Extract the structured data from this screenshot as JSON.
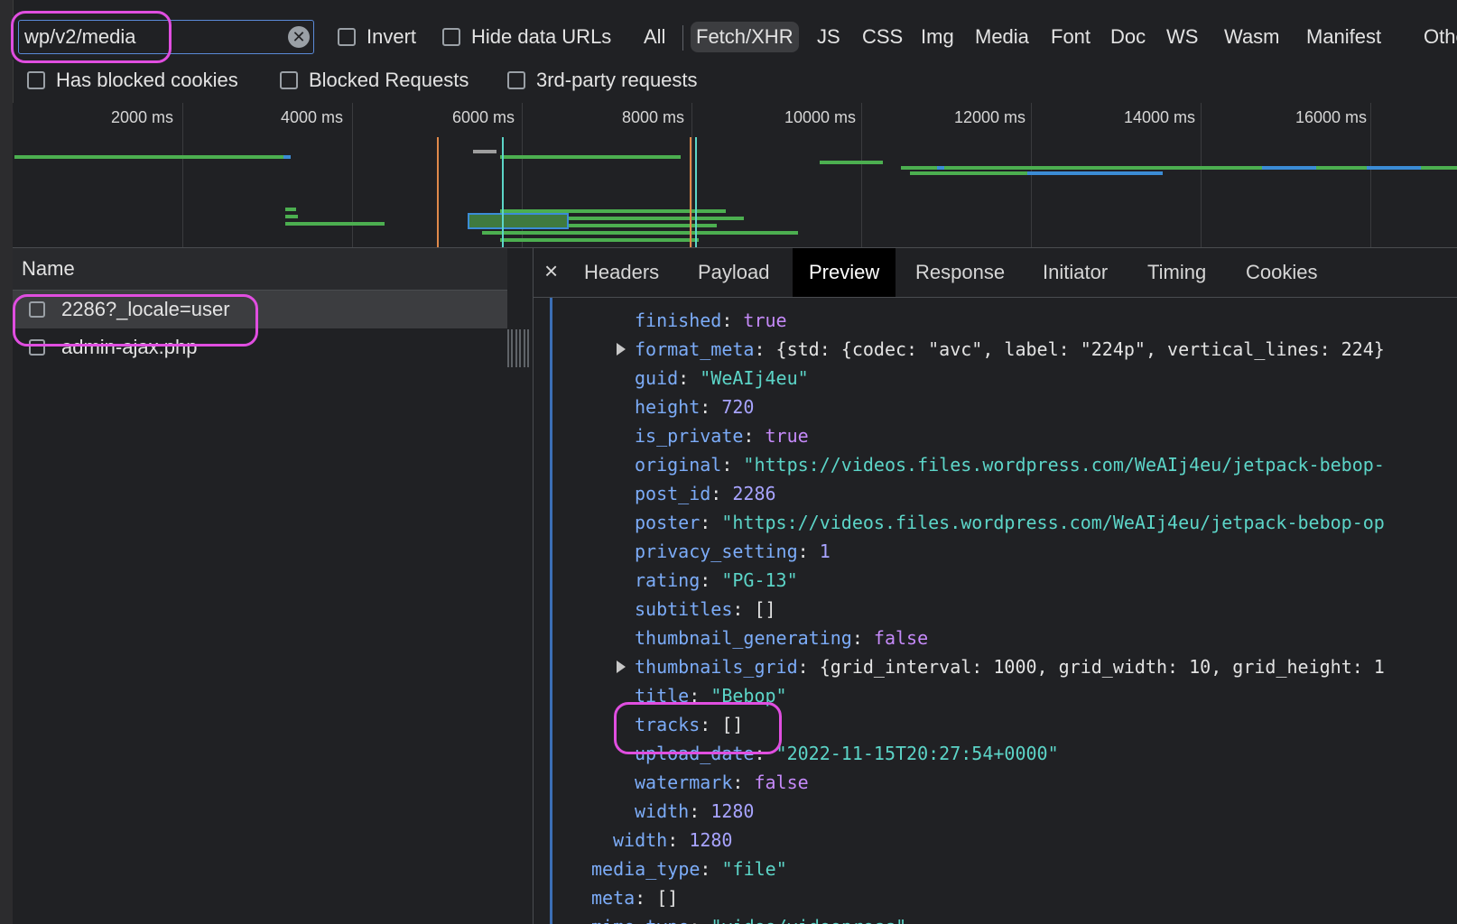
{
  "filter": {
    "search_value": "wp/v2/media",
    "invert_label": "Invert",
    "hide_data_urls_label": "Hide data URLs",
    "types": [
      "All",
      "Fetch/XHR",
      "JS",
      "CSS",
      "Img",
      "Media",
      "Font",
      "Doc",
      "WS",
      "Wasm",
      "Manifest",
      "Other"
    ],
    "active_type": "Fetch/XHR",
    "has_blocked_cookies_label": "Has blocked cookies",
    "blocked_requests_label": "Blocked Requests",
    "third_party_label": "3rd-party requests"
  },
  "timeline": {
    "ticks": [
      "2000 ms",
      "4000 ms",
      "6000 ms",
      "8000 ms",
      "10000 ms",
      "12000 ms",
      "14000 ms",
      "16000 ms"
    ]
  },
  "requests": {
    "header": "Name",
    "rows": [
      "2286?_locale=user",
      "admin-ajax.php"
    ],
    "selected": "2286?_locale=user"
  },
  "detail": {
    "close_glyph": "×",
    "tabs": [
      "Headers",
      "Payload",
      "Preview",
      "Response",
      "Initiator",
      "Timing",
      "Cookies"
    ],
    "active_tab": "Preview",
    "lines": [
      {
        "key": "finished",
        "value": "true",
        "kind": "bool",
        "indent": 1
      },
      {
        "key": "format_meta",
        "value": "{std: {codec: \"avc\", label: \"224p\", vertical_lines: 224}",
        "kind": "plain",
        "indent": 1,
        "expand": true
      },
      {
        "key": "guid",
        "value": "\"WeAIj4eu\"",
        "kind": "str",
        "indent": 1
      },
      {
        "key": "height",
        "value": "720",
        "kind": "num",
        "indent": 1
      },
      {
        "key": "is_private",
        "value": "true",
        "kind": "bool",
        "indent": 1
      },
      {
        "key": "original",
        "value": "\"https://videos.files.wordpress.com/WeAIj4eu/jetpack-bebop-",
        "kind": "str",
        "indent": 1
      },
      {
        "key": "post_id",
        "value": "2286",
        "kind": "num",
        "indent": 1
      },
      {
        "key": "poster",
        "value": "\"https://videos.files.wordpress.com/WeAIj4eu/jetpack-bebop-op",
        "kind": "str",
        "indent": 1
      },
      {
        "key": "privacy_setting",
        "value": "1",
        "kind": "num",
        "indent": 1
      },
      {
        "key": "rating",
        "value": "\"PG-13\"",
        "kind": "str",
        "indent": 1
      },
      {
        "key": "subtitles",
        "value": "[]",
        "kind": "plain",
        "indent": 1
      },
      {
        "key": "thumbnail_generating",
        "value": "false",
        "kind": "bool",
        "indent": 1
      },
      {
        "key": "thumbnails_grid",
        "value": "{grid_interval: 1000, grid_width: 10, grid_height: 1",
        "kind": "plain",
        "indent": 1,
        "expand": true
      },
      {
        "key": "title",
        "value": "\"Bebop\"",
        "kind": "str",
        "indent": 1
      },
      {
        "key": "tracks",
        "value": "[]",
        "kind": "plain",
        "indent": 1
      },
      {
        "key": "upload_date",
        "value": "\"2022-11-15T20:27:54+0000\"",
        "kind": "str",
        "indent": 1
      },
      {
        "key": "watermark",
        "value": "false",
        "kind": "bool",
        "indent": 1
      },
      {
        "key": "width",
        "value": "1280",
        "kind": "num",
        "indent": 1
      },
      {
        "key": "width",
        "value": "1280",
        "kind": "num",
        "indent": 2
      },
      {
        "key": "media_type",
        "value": "\"file\"",
        "kind": "str",
        "indent": 3
      },
      {
        "key": "meta",
        "value": "[]",
        "kind": "plain",
        "indent": 3
      },
      {
        "key": "mime_type",
        "value": "\"video/videopress\"",
        "kind": "str",
        "indent": 3
      }
    ]
  },
  "colors": {
    "highlight": "#e04ee0",
    "key": "#7cacf8",
    "string": "#5cd5c8",
    "number": "#a8a4ff",
    "boolean": "#c58af9"
  }
}
